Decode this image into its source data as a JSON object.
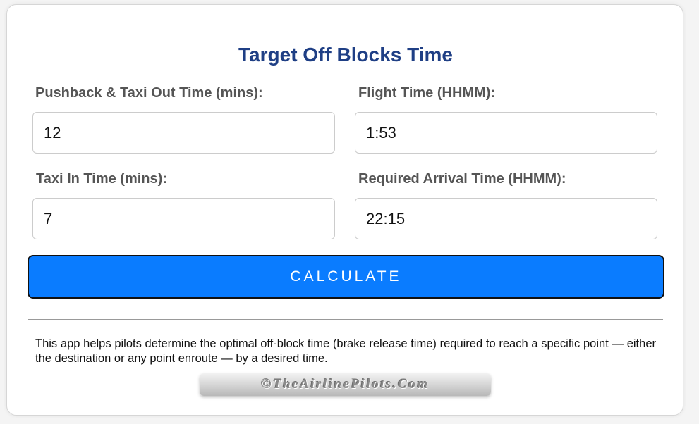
{
  "app": {
    "title": "Target Off Blocks Time"
  },
  "form": {
    "pushback_taxi_out": {
      "label": "Pushback & Taxi Out Time (mins):",
      "value": "12"
    },
    "flight_time": {
      "label": "Flight Time (HHMM):",
      "value": "1:53"
    },
    "taxi_in": {
      "label": "Taxi In Time (mins):",
      "value": "7"
    },
    "required_arrival": {
      "label": "Required Arrival Time (HHMM):",
      "value": "22:15"
    }
  },
  "actions": {
    "calculate_label": "CALCULATE"
  },
  "info": {
    "description": "This app helps pilots determine the optimal off-block time (brake release time) required to reach a specific point — either the destination or any point enroute — by a desired time."
  },
  "footer": {
    "copyright": "©TheAirlinePilots.Com"
  },
  "colors": {
    "title": "#1f3f85",
    "button": "#0a7cff",
    "label": "#555555"
  }
}
